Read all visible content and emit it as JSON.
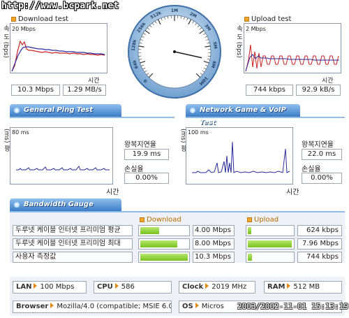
{
  "watermark_url": "http://www.bcpark.net",
  "download": {
    "title": "Download test",
    "max": "20 Mbps",
    "ylabel": "속 도 (bps)",
    "xlabel": "시간",
    "mbps": "10.3 Mbps",
    "mbs": "1.29 MB/s"
  },
  "upload": {
    "title": "Upload test",
    "max": "2 Mbps",
    "ylabel": "속 도 (bps)",
    "xlabel": "시간",
    "kbps": "744 kbps",
    "kbs": "92.9 kB/s"
  },
  "gauge": {
    "ticks": [
      "0",
      "64k",
      "128k",
      "256k",
      "512k",
      "1M",
      "2M",
      "3M",
      "5M",
      "6M",
      "10M"
    ],
    "value_fraction": 0.88
  },
  "sections": {
    "ping": "General Ping Test",
    "game": "Network Game & VoIP Test",
    "bandwidth": "Bandwidth Gauge"
  },
  "ping": {
    "max": "80 ms",
    "ylabel": "(ms) 팡",
    "xlabel": "시간",
    "rtt_label": "왕복지연율",
    "rtt": "19.9 ms",
    "loss_label": "손실율",
    "loss": "0.00%"
  },
  "game": {
    "max": "100 ms",
    "ylabel": "(ms) 팡",
    "xlabel": "시간",
    "rtt_label": "왕복지연율",
    "rtt": "22.0 ms",
    "loss_label": "손실율",
    "loss": "0.00%"
  },
  "bandwidth": {
    "download_header": "Download",
    "upload_header": "Upload",
    "rows": [
      {
        "label": "두루넷 케이블 인터넷 프리미엄 평균",
        "down": "4.00 Mbps",
        "down_frac": 0.39,
        "up": "624 kbps",
        "up_frac": 0.08
      },
      {
        "label": "두루넷 케이블 인터넷 프리미엄 최대",
        "down": "8.00 Mbps",
        "down_frac": 0.78,
        "up": "7.96 Mbps",
        "up_frac": 0.98
      },
      {
        "label": "사용자 측정값",
        "down": "10.3 Mbps",
        "down_frac": 1.0,
        "up": "744 kbps",
        "up_frac": 0.09
      }
    ]
  },
  "system": {
    "lan_key": "LAN",
    "lan": "100 Mbps",
    "cpu_key": "CPU",
    "cpu": "586",
    "clock_key": "Clock",
    "clock": "2019 MHz",
    "ram_key": "RAM",
    "ram": "512 MB",
    "browser_key": "Browser",
    "browser": "Mozilla/4.0 (compatible; MSIE 6.0",
    "os_key": "OS",
    "os": "Micros",
    "timestamp": "2003/2002-11-01 15:13:19"
  },
  "colors": {
    "accent_blue": "#3d7cc6",
    "bar_green": "#76c21e",
    "series_red": "#cc2222",
    "series_blue": "#2a2a9a"
  }
}
